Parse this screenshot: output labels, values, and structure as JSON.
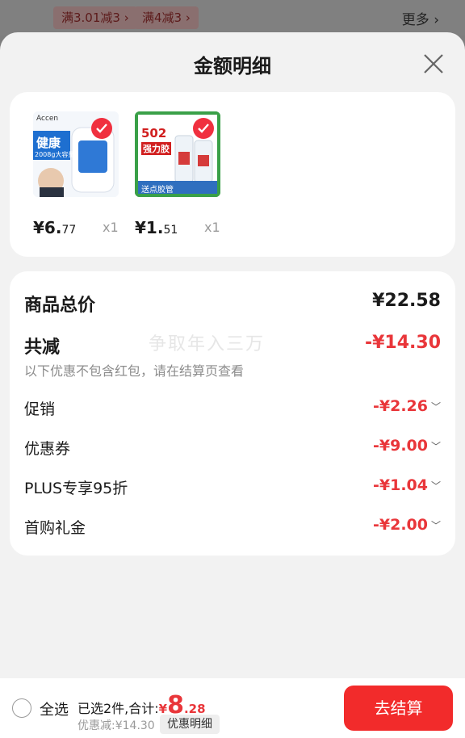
{
  "background": {
    "tags": [
      "满3.01减3 ›",
      "满4减3 ›"
    ],
    "more": "更多 ›"
  },
  "sheet": {
    "title": "金额明细"
  },
  "products": [
    {
      "brand": "Accen",
      "thumb_text_1": "健康",
      "thumb_text_2": "2008g大容量",
      "price_int": "¥6.",
      "price_dec": "77",
      "qty": "x1"
    },
    {
      "brand": "502",
      "thumb_text_1": "502",
      "thumb_text_2": "强力胶",
      "thumb_text_3": "送点胶管",
      "price_int": "¥1.",
      "price_dec": "51",
      "qty": "x1"
    }
  ],
  "detail": {
    "watermark": "争取年入三万",
    "total_label": "商品总价",
    "total_value": "¥22.58",
    "reduce_label": "共减",
    "reduce_value": "-¥14.30",
    "note": "以下优惠不包含红包，请在结算页查看",
    "items": [
      {
        "label": "促销",
        "value": "-¥2.26"
      },
      {
        "label": "优惠券",
        "value": "-¥9.00"
      },
      {
        "label": "PLUS专享95折",
        "value": "-¥1.04"
      },
      {
        "label": "首购礼金",
        "value": "-¥2.00"
      }
    ],
    "chevron": "﹀"
  },
  "bottom": {
    "select_all": "全选",
    "selected_text": "已选2件,合计:",
    "total_yen": "¥",
    "total_int": "8",
    "total_dec": ".28",
    "discount_text": "优惠减:¥14.30",
    "detail_chip": "优惠明细",
    "checkout": "去结算"
  },
  "colors": {
    "accent_red": "#e9363a",
    "button_red": "#f22b2b"
  }
}
